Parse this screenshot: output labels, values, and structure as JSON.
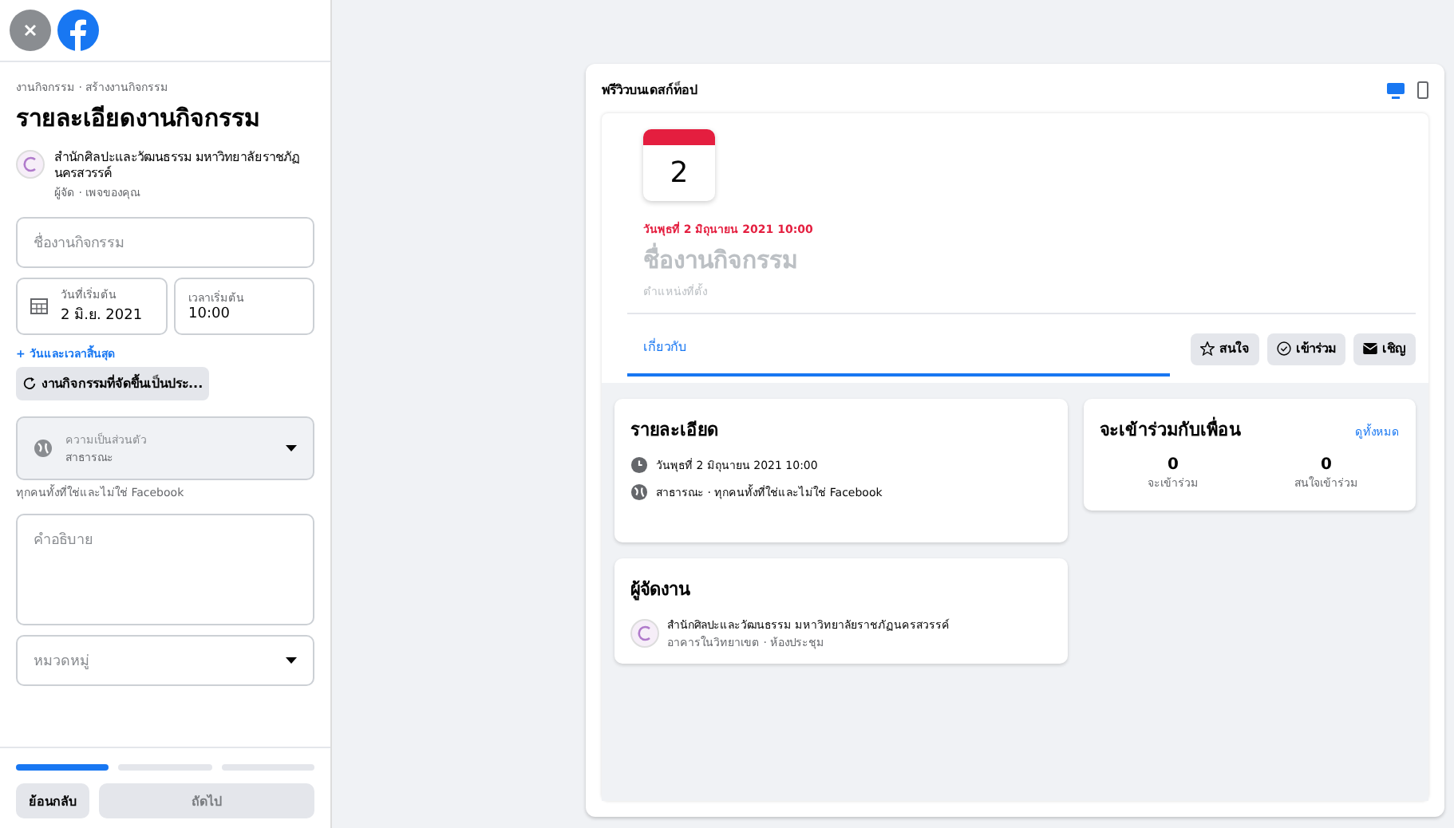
{
  "sidebar": {
    "breadcrumb": "งานกิจกรรม · สร้างงานกิจกรรม",
    "title": "รายละเอียดงานกิจกรรม",
    "host": {
      "name": "สำนักศิลปะและวัฒนธรรม มหาวิทยาลัยราชภัฏนครสวรรค์",
      "role": "ผู้จัด · เพจของคุณ"
    },
    "name_field": {
      "placeholder": "ชื่องานกิจกรรม"
    },
    "start_date": {
      "label": "วันที่เริ่มต้น",
      "value": "2 มิ.ย. 2021"
    },
    "start_time": {
      "label": "เวลาเริ่มต้น",
      "value": "10:00"
    },
    "end_link": "+ วันและเวลาสิ้นสุด",
    "recurring_chip": "งานกิจกรรมที่จัดขึ้นเป็นประ...",
    "privacy": {
      "label": "ความเป็นส่วนตัว",
      "value": "สาธารณะ",
      "disabled": true
    },
    "privacy_hint": "ทุกคนทั้งที่ใช่และไม่ใช่ Facebook",
    "description": {
      "placeholder": "คำอธิบาย"
    },
    "category": {
      "placeholder": "หมวดหมู่"
    },
    "steps": [
      {
        "done": true
      },
      {
        "done": false
      },
      {
        "done": false
      }
    ],
    "buttons": [
      {
        "label": "ย้อนกลับ",
        "disabled": false
      },
      {
        "label": "ถัดไป",
        "disabled": true
      }
    ]
  },
  "preview": {
    "title": "พรีวิวบนเดสก์ท็อป",
    "devices": [
      {
        "kind": "desktop",
        "selected": true
      },
      {
        "kind": "mobile",
        "selected": false
      }
    ],
    "calendar_day": "2",
    "date": "วันพุธที่ 2 มิถุนายน 2021 10:00",
    "event_name": "ชื่องานกิจกรรม",
    "location": "ตำแหน่งที่ตั้ง",
    "tabs": [
      {
        "label": "เกี่ยวกับ",
        "selected": true
      }
    ],
    "actions": [
      {
        "kind": "star",
        "label": "สนใจ"
      },
      {
        "kind": "check",
        "label": "เข้าร่วม"
      },
      {
        "kind": "mail",
        "label": "เชิญ"
      }
    ],
    "details": {
      "title": "รายละเอียด",
      "rows": [
        {
          "kind": "clock",
          "text": "วันพุธที่ 2 มิถุนายน 2021 10:00"
        },
        {
          "kind": "globe",
          "text": "สาธารณะ · ทุกคนทั้งที่ใช่และไม่ใช่ Facebook"
        }
      ]
    },
    "organizer": {
      "title": "ผู้จัดงาน",
      "name": "สำนักศิลปะและวัฒนธรรม มหาวิทยาลัยราชภัฏนครสวรรค์",
      "place": "อาคารในวิทยาเขต · ห้องประชุม"
    },
    "friends": {
      "title": "จะเข้าร่วมกับเพื่อน",
      "link": "ดูทั้งหมด",
      "stats": [
        {
          "value": "0",
          "label": "จะเข้าร่วม"
        },
        {
          "value": "0",
          "label": "สนใจเข้าร่วม"
        }
      ]
    }
  }
}
